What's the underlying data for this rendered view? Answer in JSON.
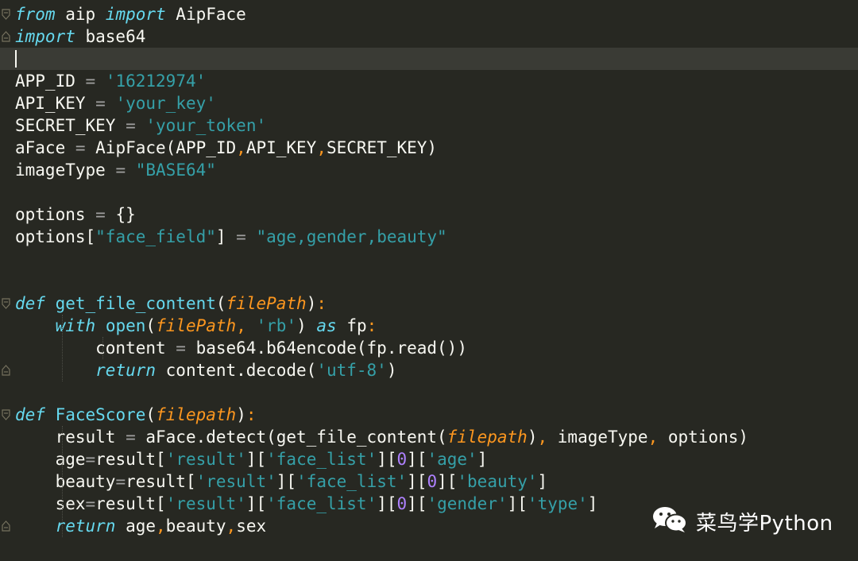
{
  "editor": {
    "lines": [
      [
        {
          "t": "from",
          "c": "kw"
        },
        {
          "t": " aip ",
          "c": "id"
        },
        {
          "t": "import",
          "c": "kw"
        },
        {
          "t": " AipFace",
          "c": "id"
        }
      ],
      [
        {
          "t": "import",
          "c": "kw"
        },
        {
          "t": " base64",
          "c": "id"
        }
      ],
      [],
      [
        {
          "t": "APP_ID ",
          "c": "id"
        },
        {
          "t": "=",
          "c": "op"
        },
        {
          "t": " ",
          "c": "id"
        },
        {
          "t": "'16212974'",
          "c": "str"
        }
      ],
      [
        {
          "t": "API_KEY ",
          "c": "id"
        },
        {
          "t": "=",
          "c": "op"
        },
        {
          "t": " ",
          "c": "id"
        },
        {
          "t": "'your_key'",
          "c": "str"
        }
      ],
      [
        {
          "t": "SECRET_KEY ",
          "c": "id"
        },
        {
          "t": "=",
          "c": "op"
        },
        {
          "t": " ",
          "c": "id"
        },
        {
          "t": "'your_token'",
          "c": "str"
        }
      ],
      [
        {
          "t": "aFace ",
          "c": "id"
        },
        {
          "t": "=",
          "c": "op"
        },
        {
          "t": " AipFace(APP_ID",
          "c": "id"
        },
        {
          "t": ",",
          "c": "sep"
        },
        {
          "t": "API_KEY",
          "c": "id"
        },
        {
          "t": ",",
          "c": "sep"
        },
        {
          "t": "SECRET_KEY)",
          "c": "id"
        }
      ],
      [
        {
          "t": "imageType ",
          "c": "id"
        },
        {
          "t": "=",
          "c": "op"
        },
        {
          "t": " ",
          "c": "id"
        },
        {
          "t": "\"BASE64\"",
          "c": "str"
        }
      ],
      [],
      [
        {
          "t": "options ",
          "c": "id"
        },
        {
          "t": "=",
          "c": "op"
        },
        {
          "t": " {}",
          "c": "id"
        }
      ],
      [
        {
          "t": "options[",
          "c": "id"
        },
        {
          "t": "\"face_field\"",
          "c": "str"
        },
        {
          "t": "] ",
          "c": "id"
        },
        {
          "t": "=",
          "c": "op"
        },
        {
          "t": " ",
          "c": "id"
        },
        {
          "t": "\"age,gender,beauty\"",
          "c": "str"
        }
      ],
      [],
      [],
      [
        {
          "t": "def",
          "c": "kw"
        },
        {
          "t": " ",
          "c": "id"
        },
        {
          "t": "get_file_content",
          "c": "fn"
        },
        {
          "t": "(",
          "c": "id"
        },
        {
          "t": "filePath",
          "c": "prm"
        },
        {
          "t": ")",
          "c": "id"
        },
        {
          "t": ":",
          "c": "sep"
        }
      ],
      [
        {
          "t": "    ",
          "c": "id"
        },
        {
          "t": "with",
          "c": "kw"
        },
        {
          "t": " ",
          "c": "id"
        },
        {
          "t": "open",
          "c": "fn"
        },
        {
          "t": "(",
          "c": "id"
        },
        {
          "t": "filePath",
          "c": "prm"
        },
        {
          "t": ",",
          "c": "sep"
        },
        {
          "t": " ",
          "c": "id"
        },
        {
          "t": "'rb'",
          "c": "str"
        },
        {
          "t": ") ",
          "c": "id"
        },
        {
          "t": "as",
          "c": "kw"
        },
        {
          "t": " fp",
          "c": "id"
        },
        {
          "t": ":",
          "c": "sep"
        }
      ],
      [
        {
          "t": "        content ",
          "c": "id"
        },
        {
          "t": "=",
          "c": "op"
        },
        {
          "t": " base64.b64encode(fp.read())",
          "c": "id"
        }
      ],
      [
        {
          "t": "        ",
          "c": "id"
        },
        {
          "t": "return",
          "c": "kw"
        },
        {
          "t": " content.decode(",
          "c": "id"
        },
        {
          "t": "'utf-8'",
          "c": "str"
        },
        {
          "t": ")",
          "c": "id"
        }
      ],
      [],
      [
        {
          "t": "def",
          "c": "kw"
        },
        {
          "t": " ",
          "c": "id"
        },
        {
          "t": "FaceScore",
          "c": "fn"
        },
        {
          "t": "(",
          "c": "id"
        },
        {
          "t": "filepath",
          "c": "prm"
        },
        {
          "t": ")",
          "c": "id"
        },
        {
          "t": ":",
          "c": "sep"
        }
      ],
      [
        {
          "t": "    result ",
          "c": "id"
        },
        {
          "t": "=",
          "c": "op"
        },
        {
          "t": " aFace.detect(get_file_content(",
          "c": "id"
        },
        {
          "t": "filepath",
          "c": "prm"
        },
        {
          "t": ")",
          "c": "id"
        },
        {
          "t": ",",
          "c": "sep"
        },
        {
          "t": " imageType",
          "c": "id"
        },
        {
          "t": ",",
          "c": "sep"
        },
        {
          "t": " options)",
          "c": "id"
        }
      ],
      [
        {
          "t": "    age",
          "c": "id"
        },
        {
          "t": "=",
          "c": "op"
        },
        {
          "t": "result[",
          "c": "id"
        },
        {
          "t": "'result'",
          "c": "str"
        },
        {
          "t": "][",
          "c": "id"
        },
        {
          "t": "'face_list'",
          "c": "str"
        },
        {
          "t": "][",
          "c": "id"
        },
        {
          "t": "0",
          "c": "num"
        },
        {
          "t": "][",
          "c": "id"
        },
        {
          "t": "'age'",
          "c": "str"
        },
        {
          "t": "]",
          "c": "id"
        }
      ],
      [
        {
          "t": "    beauty",
          "c": "id"
        },
        {
          "t": "=",
          "c": "op"
        },
        {
          "t": "result[",
          "c": "id"
        },
        {
          "t": "'result'",
          "c": "str"
        },
        {
          "t": "][",
          "c": "id"
        },
        {
          "t": "'face_list'",
          "c": "str"
        },
        {
          "t": "][",
          "c": "id"
        },
        {
          "t": "0",
          "c": "num"
        },
        {
          "t": "][",
          "c": "id"
        },
        {
          "t": "'beauty'",
          "c": "str"
        },
        {
          "t": "]",
          "c": "id"
        }
      ],
      [
        {
          "t": "    sex",
          "c": "id"
        },
        {
          "t": "=",
          "c": "op"
        },
        {
          "t": "result[",
          "c": "id"
        },
        {
          "t": "'result'",
          "c": "str"
        },
        {
          "t": "][",
          "c": "id"
        },
        {
          "t": "'face_list'",
          "c": "str"
        },
        {
          "t": "][",
          "c": "id"
        },
        {
          "t": "0",
          "c": "num"
        },
        {
          "t": "][",
          "c": "id"
        },
        {
          "t": "'gender'",
          "c": "str"
        },
        {
          "t": "][",
          "c": "id"
        },
        {
          "t": "'type'",
          "c": "str"
        },
        {
          "t": "]",
          "c": "id"
        }
      ],
      [
        {
          "t": "    ",
          "c": "id"
        },
        {
          "t": "return",
          "c": "kw"
        },
        {
          "t": " age",
          "c": "id"
        },
        {
          "t": ",",
          "c": "sep"
        },
        {
          "t": "beauty",
          "c": "id"
        },
        {
          "t": ",",
          "c": "sep"
        },
        {
          "t": "sex",
          "c": "id"
        }
      ]
    ],
    "current_line": 3,
    "fold_open_lines": [
      1,
      14,
      19
    ],
    "fold_close_lines": [
      2,
      17,
      24
    ],
    "theme_colors": {
      "background": "#272822",
      "keyword": "#66d9ef",
      "parameter": "#fd971f",
      "string": "#35a0a8",
      "number": "#ae81ff",
      "text": "#f8f8f2"
    }
  },
  "watermark": {
    "icon": "wechat-icon",
    "text": "菜鸟学Python"
  }
}
